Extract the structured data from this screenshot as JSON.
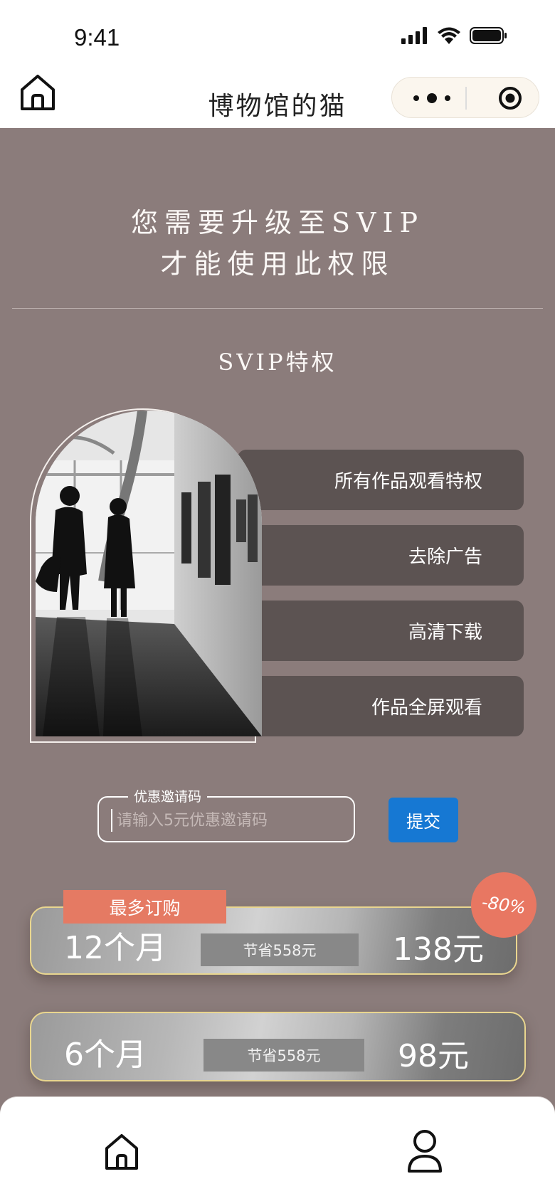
{
  "status_bar": {
    "time": "9:41"
  },
  "nav": {
    "title": "博物馆的猫"
  },
  "headline": {
    "line1": "您需要升级至SVIP",
    "line2": "才能使用此权限"
  },
  "privileges": {
    "title": "SVIP特权",
    "items": [
      "所有作品观看特权",
      "去除广告",
      "高清下载",
      "作品全屏观看"
    ]
  },
  "coupon": {
    "legend": "优惠邀请码",
    "placeholder": "请输入5元优惠邀请码",
    "value": "",
    "submit_label": "提交"
  },
  "plans": [
    {
      "months": "12个月",
      "save": "节省558元",
      "price": "138元",
      "tag": "最多订购",
      "discount": "-80%"
    },
    {
      "months": "6个月",
      "save": "节省558元",
      "price": "98元"
    }
  ],
  "tabbar": {
    "items": [
      "home-icon",
      "user-icon"
    ]
  },
  "colors": {
    "background": "#8b7c7b",
    "perk_bg": "#5c5352",
    "accent": "#e57a63",
    "button": "#1678d3",
    "gold_border": "#e9d68f"
  }
}
